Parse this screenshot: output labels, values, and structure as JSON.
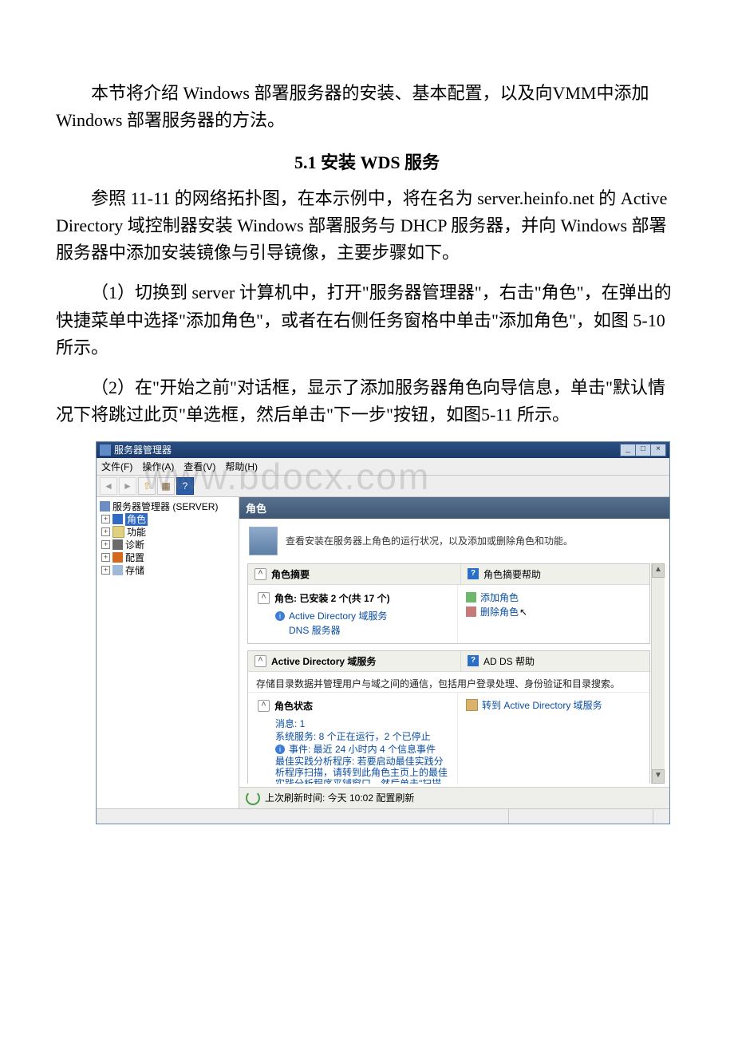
{
  "intro_para": "本节将介绍 Windows 部署服务器的安装、基本配置，以及向VMM中添加 Windows 部署服务器的方法。",
  "section_heading": "5.1 安装 WDS 服务",
  "para_ref": "参照 11-11 的网络拓扑图，在本示例中，将在名为 server.heinfo.net 的 Active Directory 域控制器安装 Windows 部署服务与 DHCP 服务器，并向 Windows 部署服务器中添加安装镜像与引导镜像，主要步骤如下。",
  "para_step1": "（1）切换到 server 计算机中，打开\"服务器管理器\"，右击\"角色\"，在弹出的快捷菜单中选择\"添加角色\"，或者在右侧任务窗格中单击\"添加角色\"，如图 5-10 所示。",
  "para_step2": "（2）在\"开始之前\"对话框，显示了添加服务器角色向导信息，单击\"默认情况下将跳过此页\"单选框，然后单击\"下一步\"按钮，如图5-11 所示。",
  "screenshot": {
    "watermark": "www.bdocx.com",
    "title": "服务器管理器",
    "menu": {
      "file": "文件(F)",
      "action": "操作(A)",
      "view": "查看(V)",
      "help": "帮助(H)"
    },
    "tree": {
      "root": "服务器管理器 (SERVER)",
      "items": [
        "角色",
        "功能",
        "诊断",
        "配置",
        "存储"
      ]
    },
    "content": {
      "header": "角色",
      "subtitle": "查看安装在服务器上角色的运行状况，以及添加或删除角色和功能。",
      "summary": {
        "title": "角色摘要",
        "help": "角色摘要帮助",
        "roles_label": "角色: 已安装 2 个(共 17 个)",
        "role1": "Active Directory 域服务",
        "role2": "DNS 服务器",
        "add": "添加角色",
        "remove": "删除角色"
      },
      "adds": {
        "title": "Active Directory 域服务",
        "help": "AD DS 帮助",
        "desc": "存储目录数据并管理用户与域之间的通信，包括用户登录处理、身份验证和目录搜索。",
        "status_title": "角色状态",
        "goto": "转到 Active Directory 域服务",
        "msg": "消息: 1",
        "svc": "系统服务: 8 个正在运行，2 个已停止",
        "evt": "事件: 最近 24 小时内 4 个信息事件",
        "bpa": "最佳实践分析程序: 若要启动最佳实践分析程序扫描，请转到此角色主页上的最佳实践分析程序平铺窗口，然后单击\"扫描此角色\""
      },
      "refresh": "上次刷新时间: 今天 10:02 配置刷新"
    }
  }
}
